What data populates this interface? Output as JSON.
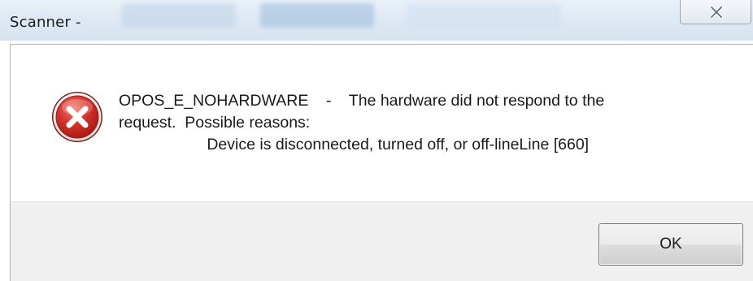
{
  "window": {
    "title": "Scanner -"
  },
  "dialog": {
    "icon": "error-icon",
    "message_lines": [
      "OPOS_E_NOHARDWARE    -    The hardware did not respond to the",
      "request.  Possible reasons:",
      "                    Device is disconnected, turned off, or off-lineLine [660]"
    ],
    "ok_label": "OK"
  },
  "colors": {
    "error_red": "#d8362f",
    "footer_bg": "#f0f0f0",
    "titlebar_bg": "#dfe9f4"
  }
}
